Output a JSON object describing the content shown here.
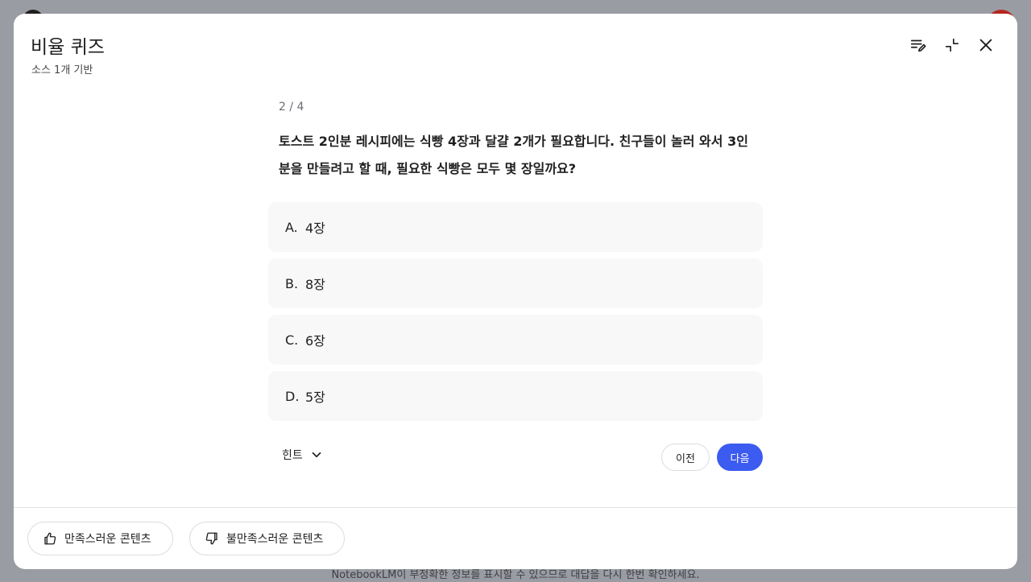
{
  "modal": {
    "title": "비율 퀴즈",
    "subtitle": "소스 1개 기반"
  },
  "header_icons": [
    "edit-list-icon",
    "collapse-icon",
    "close-icon"
  ],
  "quiz": {
    "progress": "2 / 4",
    "question": "토스트 2인분 레시피에는 식빵 4장과 달걀 2개가 필요합니다. 친구들이 놀러 와서 3인분을 만들려고 할 때, 필요한 식빵은 모두 몇 장일까요?",
    "options": [
      {
        "letter": "A.",
        "text": "4장"
      },
      {
        "letter": "B.",
        "text": "8장"
      },
      {
        "letter": "C.",
        "text": "6장"
      },
      {
        "letter": "D.",
        "text": "5장"
      }
    ],
    "hint_label": "힌트",
    "prev_label": "이전",
    "next_label": "다음"
  },
  "feedback": {
    "good_label": "만족스러운 콘텐츠",
    "bad_label": "불만족스러운 콘텐츠"
  },
  "background": {
    "footnote": "NotebookLM이 부정확한 정보를 표시할 수 있으므로 대답을 다시 한번 확인하세요."
  },
  "colors": {
    "accent": "#3c5bf0",
    "overlay": "#9a9ca3",
    "option_bg": "#f8f8f8"
  }
}
